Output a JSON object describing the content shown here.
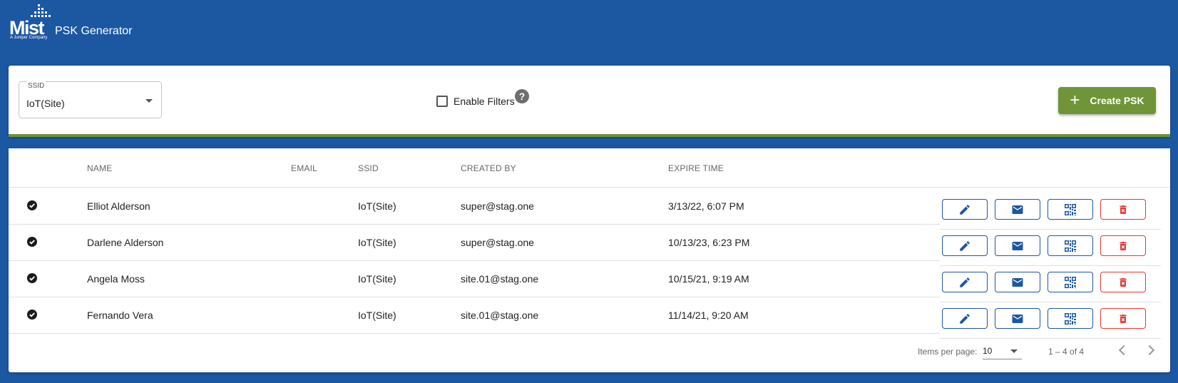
{
  "header": {
    "logo_text": "Mist",
    "logo_sub": "A Juniper Company",
    "app_title": "PSK Generator"
  },
  "filters": {
    "ssid_label": "SSID",
    "ssid_value": "IoT(Site)",
    "enable_filters_label": "Enable Filters",
    "enable_filters_checked": false,
    "help_icon": "question-circle-icon",
    "create_label": "Create PSK"
  },
  "table": {
    "columns": [
      "NAME",
      "EMAIL",
      "SSID",
      "CREATED BY",
      "EXPIRE TIME"
    ],
    "rows": [
      {
        "name": "Elliot Alderson",
        "email": "",
        "ssid": "IoT(Site)",
        "created_by": "super@stag.one",
        "expire": "3/13/22, 6:07 PM"
      },
      {
        "name": "Darlene Alderson",
        "email": "",
        "ssid": "IoT(Site)",
        "created_by": "super@stag.one",
        "expire": "10/13/23, 6:23 PM"
      },
      {
        "name": "Angela Moss",
        "email": "",
        "ssid": "IoT(Site)",
        "created_by": "site.01@stag.one",
        "expire": "10/15/21, 9:19 AM"
      },
      {
        "name": "Fernando Vera",
        "email": "",
        "ssid": "IoT(Site)",
        "created_by": "site.01@stag.one",
        "expire": "11/14/21, 9:20 AM"
      }
    ],
    "row_icons": [
      "check-circle-icon",
      "pencil-icon",
      "envelope-icon",
      "qr-code-icon",
      "trash-icon"
    ]
  },
  "paginator": {
    "items_per_page_label": "Items per page:",
    "items_per_page": "10",
    "range": "1 – 4 of 4"
  },
  "colors": {
    "background": "#1c57a2",
    "accent_green": "#6f9538",
    "action_blue": "#1c57a2",
    "delete_red": "#e53935"
  }
}
